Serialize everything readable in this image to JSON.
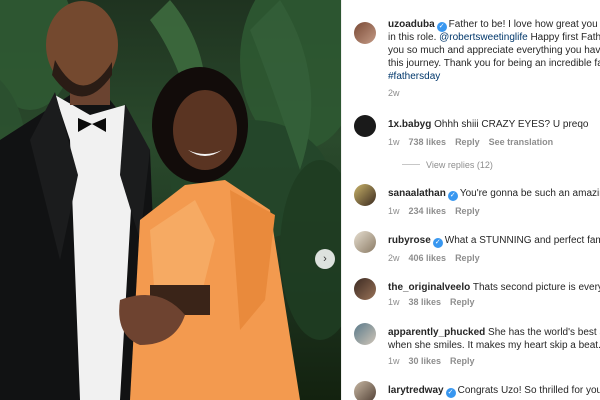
{
  "post": {
    "author": "uzoaduba",
    "caption_lines": [
      "Father to be! I love how great you are",
      "in this role. @robertsweetinglife Happy first Father's",
      "you so much and appreciate everything you have",
      "this journey. Thank you for being an incredible fa",
      "#fathersday"
    ],
    "caption_line1_text": "Father to be! I love how great you a",
    "caption_line2_pre": "in this role. ",
    "caption_line2_tag": "@robertsweetinglife",
    "caption_line2_post": " Happy first Fathe",
    "caption_line3": "you so much and appreciate everything you have",
    "caption_line4": "this journey. Thank you for being an incredible fa",
    "caption_line5": "#fathersday",
    "time": "2w"
  },
  "labels": {
    "reply": "Reply",
    "see_translation": "See translation",
    "view_replies": "View replies (12)",
    "next_icon": "›"
  },
  "comments": [
    {
      "user": "1x.babyg",
      "verified": false,
      "text": "Ohhh shiii CRAZY EYES? U preqo",
      "time": "1w",
      "likes": "738 likes",
      "translation": true
    },
    {
      "user": "sanaalathan",
      "verified": true,
      "text": "You're gonna be such an amazing",
      "time": "1w",
      "likes": "234 likes"
    },
    {
      "user": "rubyrose",
      "verified": true,
      "text": "What a STUNNING and perfect family",
      "time": "2w",
      "likes": "406 likes"
    },
    {
      "user": "the_originalveelo",
      "verified": false,
      "text": "Thats second picture is everyth",
      "time": "1w",
      "likes": "38 likes"
    },
    {
      "user": "apparently_phucked",
      "verified": false,
      "text": "She has the world's best sm",
      "text2": "when she smiles. It makes my heart skip a beat.",
      "time": "1w",
      "likes": "30 likes"
    },
    {
      "user": "larytredway",
      "verified": true,
      "text": "Congrats Uzo! So thrilled for you a",
      "time": "",
      "likes": ""
    }
  ],
  "colors": {
    "verified": "#3897f0",
    "mention": "#00376b",
    "outfit": "#f39a4f"
  },
  "icons": [
    "verified-badge-icon",
    "chevron-right-icon"
  ]
}
